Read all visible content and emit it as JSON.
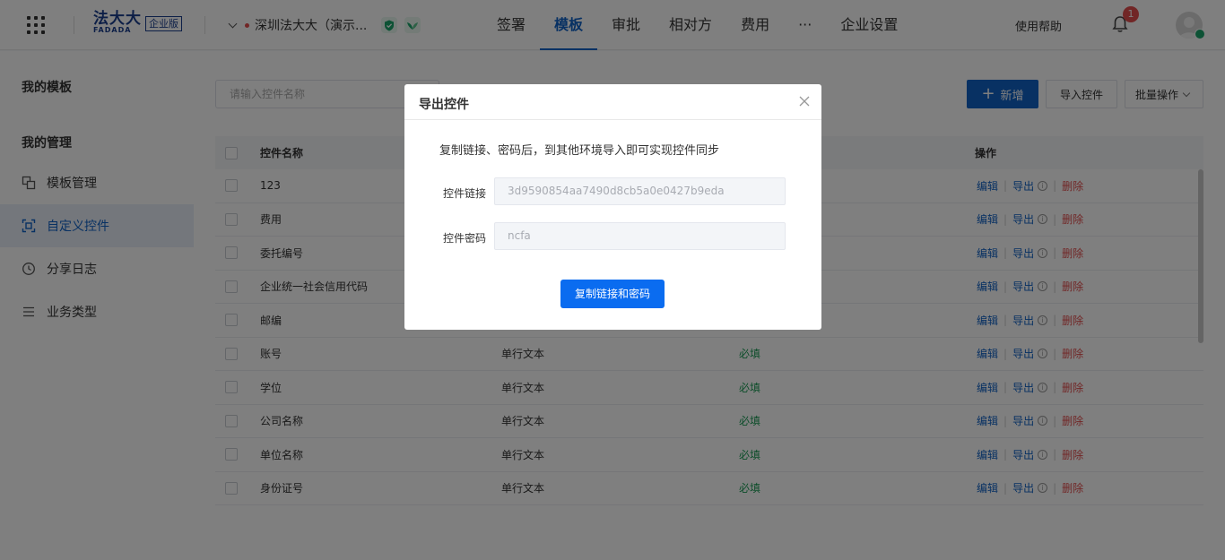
{
  "header": {
    "logo_text": "法大大",
    "logo_sub": "FADADA",
    "logo_badge": "企业版",
    "company_name": "深圳法大大（演示...",
    "nav": [
      "签署",
      "模板",
      "审批",
      "相对方",
      "费用",
      "···",
      "企业设置"
    ],
    "active_nav": "模板",
    "help": "使用帮助",
    "notification_count": "1",
    "accent_color": "#1062c6"
  },
  "sidebar": {
    "my_templates": "我的模板",
    "my_management": "我的管理",
    "items": [
      {
        "label": "模板管理",
        "icon": "template-manage-icon"
      },
      {
        "label": "自定义控件",
        "icon": "custom-control-icon"
      },
      {
        "label": "分享日志",
        "icon": "clock-icon"
      },
      {
        "label": "业务类型",
        "icon": "list-icon"
      }
    ],
    "active_item": "自定义控件"
  },
  "toolbar": {
    "search_placeholder": "请输入控件名称",
    "add_label": "新增",
    "import_label": "导入控件",
    "batch_label": "批量操作"
  },
  "table": {
    "columns": {
      "name": "控件名称",
      "ops": "操作"
    },
    "rows": [
      {
        "name": "123",
        "type": "",
        "required": ""
      },
      {
        "name": "费用",
        "type": "",
        "required": ""
      },
      {
        "name": "委托编号",
        "type": "",
        "required": ""
      },
      {
        "name": "企业统一社会信用代码",
        "type": "",
        "required": ""
      },
      {
        "name": "邮编",
        "type": "",
        "required": ""
      },
      {
        "name": "账号",
        "type": "单行文本",
        "required": "必填"
      },
      {
        "name": "学位",
        "type": "单行文本",
        "required": "必填"
      },
      {
        "name": "公司名称",
        "type": "单行文本",
        "required": "必填"
      },
      {
        "name": "单位名称",
        "type": "单行文本",
        "required": "必填"
      },
      {
        "name": "身份证号",
        "type": "单行文本",
        "required": "必填"
      }
    ],
    "ops": {
      "edit": "编辑",
      "export": "导出",
      "delete": "删除"
    }
  },
  "modal": {
    "title": "导出控件",
    "description": "复制链接、密码后，到其他环境导入即可实现控件同步",
    "link_label": "控件链接",
    "link_value": "3d9590854aa7490d8cb5a0e0427b9eda",
    "password_label": "控件密码",
    "password_value": "ncfa",
    "copy_button": "复制链接和密码"
  }
}
